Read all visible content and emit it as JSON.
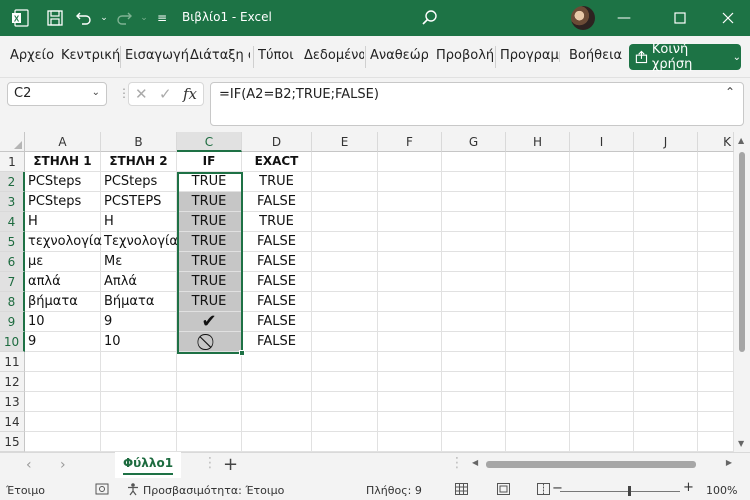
{
  "titlebar": {
    "title": "Βιβλίο1  -  Excel"
  },
  "ribbon": {
    "tabs": [
      "Αρχείο",
      "Κεντρική",
      "Εισαγωγή",
      "Διάταξη σ",
      "Τύποι",
      "Δεδομένα",
      "Αναθεώρ",
      "Προβολή",
      "Προγραμμ",
      "Βοήθεια"
    ],
    "share_label": "Κοινή χρήση"
  },
  "formula_bar": {
    "name_box": "C2",
    "formula": "=IF(A2=B2;TRUE;FALSE)"
  },
  "columns": [
    "A",
    "B",
    "C",
    "D",
    "E",
    "F",
    "G",
    "H",
    "I",
    "J",
    "K"
  ],
  "rows": [
    "1",
    "2",
    "3",
    "4",
    "5",
    "6",
    "7",
    "8",
    "9",
    "10",
    "11",
    "12",
    "13",
    "14",
    "15"
  ],
  "cells": {
    "headers": [
      "ΣΤΗΛΗ 1",
      "ΣΤΗΛΗ 2",
      "IF",
      "EXACT"
    ],
    "data": [
      [
        "PCSteps",
        "PCSteps",
        "TRUE",
        "TRUE"
      ],
      [
        "PCSteps",
        "PCSTEPS",
        "TRUE",
        "FALSE"
      ],
      [
        "Η",
        "Η",
        "TRUE",
        "TRUE"
      ],
      [
        "τεχνολογία",
        "Τεχνολογία",
        "TRUE",
        "FALSE"
      ],
      [
        "με",
        "Με",
        "TRUE",
        "FALSE"
      ],
      [
        "απλά",
        "Απλά",
        "TRUE",
        "FALSE"
      ],
      [
        "βήματα",
        "Βήματα",
        "TRUE",
        "FALSE"
      ],
      [
        "10",
        "9",
        "✔",
        "FALSE"
      ],
      [
        "9",
        "10",
        "⃠",
        "FALSE"
      ]
    ],
    "icons": [
      "check-icon",
      "prohibited-icon"
    ]
  },
  "sheets": {
    "active": "Φύλλο1"
  },
  "status": {
    "ready": "Έτοιμο",
    "accessibility": "Προσβασιμότητα: Έτοιμο",
    "count": "Πλήθος: 9",
    "zoom": "100%"
  },
  "colors": {
    "accent": "#1d7345",
    "selection": "#c6c6c6"
  }
}
